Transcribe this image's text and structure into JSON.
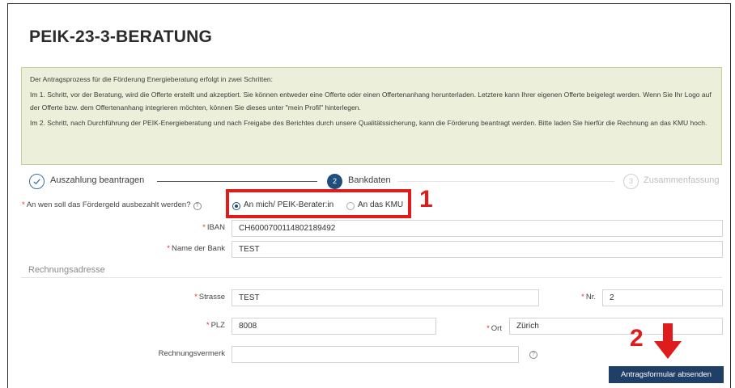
{
  "page": {
    "title": "PEIK-23-3-BERATUNG"
  },
  "info": {
    "line1": "Der Antragsprozess für die Förderung Energieberatung erfolgt in zwei Schritten:",
    "line2": "Im 1. Schritt, vor der Beratung, wird die Offerte erstellt und akzeptiert. Sie können entweder eine Offerte oder einen Offertenanhang herunterladen. Letztere kann Ihrer eigenen Offerte beigelegt werden. Wenn Sie Ihr Logo auf der Offerte bzw. dem Offertenanhang integrieren möchten, können Sie dieses unter \"mein Profil\" hinterlegen.",
    "line3": "Im 2. Schritt, nach Durchführung der PEIK-Energieberatung und nach Freigabe des Berichtes durch unsere Qualitätssicherung, kann die Förderung beantragt werden. Bitte laden Sie hierfür die Rechnung an das KMU hoch."
  },
  "steps": {
    "step1": {
      "label": "Auszahlung beantragen",
      "icon": "check-icon",
      "state": "done"
    },
    "step2": {
      "number": "2",
      "label": "Bankdaten",
      "state": "active"
    },
    "step3": {
      "number": "3",
      "label": "Zusammenfassung",
      "state": "pending"
    }
  },
  "form": {
    "recipient": {
      "label": "An wen soll das Fördergeld ausbezahlt werden?",
      "options": [
        "An mich/ PEIK-Berater:in",
        "An das KMU"
      ],
      "selected": "An mich/ PEIK-Berater:in"
    },
    "iban": {
      "label": "IBAN",
      "value": "CH6000700114802189492"
    },
    "bank": {
      "label": "Name der Bank",
      "value": "TEST"
    },
    "section": "Rechnungsadresse",
    "street": {
      "label": "Strasse",
      "value": "TEST"
    },
    "number": {
      "label": "Nr.",
      "value": "2"
    },
    "plz": {
      "label": "PLZ",
      "value": "8008"
    },
    "city": {
      "label": "Ort",
      "value": "Zürich"
    },
    "note": {
      "label": "Rechnungsvermerk",
      "value": ""
    },
    "submit": "Antragsformular absenden"
  },
  "annotations": {
    "first": "1",
    "second": "2"
  },
  "colors": {
    "accent": "#1f4d7c",
    "annotation": "#e01b1b",
    "info_bg": "#ecefd9",
    "required": "#e2332b"
  }
}
